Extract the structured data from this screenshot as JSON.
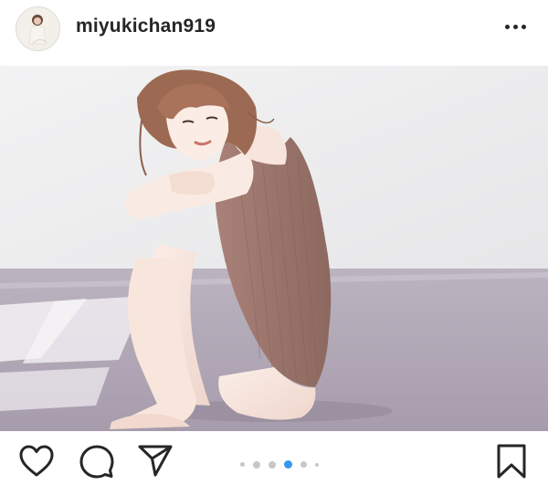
{
  "post": {
    "username": "miyukichan919",
    "carousel": {
      "total_dots": 6,
      "active_index": 3
    }
  },
  "icons": {
    "avatar": "avatar",
    "more": "more-horizontal-icon",
    "like": "heart-icon",
    "comment": "comment-bubble-icon",
    "share": "paper-plane-icon",
    "save": "bookmark-icon"
  },
  "colors": {
    "text": "#262626",
    "accent_dot": "#3897f0",
    "inactive_dot": "#c7c7c7",
    "swimsuit": "#9a756c",
    "floor": "#b3a9b8",
    "wall": "#eeeeef"
  }
}
